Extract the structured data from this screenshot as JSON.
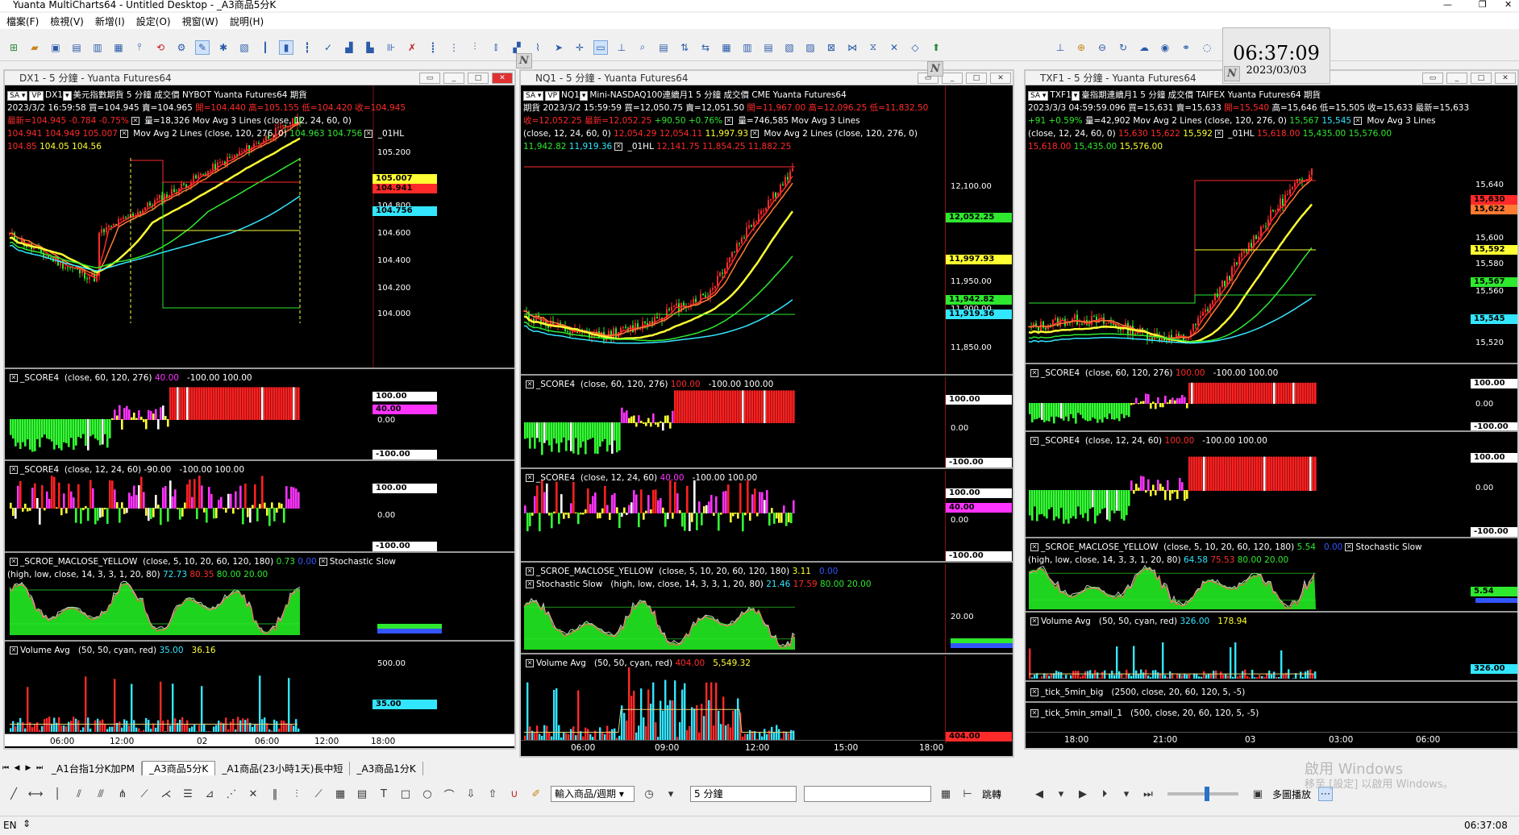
{
  "window": {
    "title": "Yuanta MultiCharts64 - Untitled Desktop - _A3商品5分K"
  },
  "menu": [
    "檔案(F)",
    "檢視(V)",
    "新增(I)",
    "設定(O)",
    "視窗(W)",
    "說明(H)"
  ],
  "clock": {
    "time": "06:37:09",
    "date": "2023/03/03"
  },
  "windows": [
    {
      "title": "DX1 - 5 分鐘 - Yuanta Futures64",
      "line1": "美元指數期貨  5 分鐘   成交價  NYBOT  Yuanta Futures64  期貨",
      "line2_white": "2023/3/2  16:59:58  買=104.945  賣=104.965 ",
      "line2_red": "開=104.440  高=105.155  低=104.420  收=104.945",
      "line3_red": "最新=104.945  -0.784  -0.75%",
      "line3_white": "  量=18,326   Mov Avg 3 Lines    (close,  12,  24,  60,  0)",
      "line4_red": "104.941  104.949  105.007",
      "line4_white": "  Mov Avg 2 Lines    (close,  120,  276,  0)  ",
      "line4_grn": "104.963  104.756",
      "line4_end": "  _01HL",
      "line5_red": "104.85",
      "line5_yel": "  104.05  104.56",
      "price_labels": [
        "105.200",
        "104.800",
        "104.600",
        "104.400",
        "104.200",
        "104.000"
      ],
      "price_tags": [
        "105.007",
        "104.941",
        "104.756"
      ],
      "p2": {
        "name": "_SCORE4",
        "params": "(close,  60,  120,  276)",
        "v": "40.00",
        "rng": "-100.00  100.00",
        "labels": [
          "100.00",
          "40.00",
          "0.00",
          "-100.00"
        ]
      },
      "p3": {
        "name": "_SCORE4",
        "params": "(close,  12,  24,  60)",
        "v": "-90.00",
        "rng": "-100.00  100.00",
        "labels": [
          "100.00",
          "0.00",
          "-100.00"
        ]
      },
      "p4": {
        "name": "_SCROE_MACLOSE_YELLOW",
        "params": "(close,  5,  10,  20,  60,  120,  180)",
        "v1": "0.73",
        "v2": "0.00",
        "name2": "Stochastic Slow",
        "params2": "(high,  low,  close,  14,  3,  3,  1,  20,  80)",
        "s1": "72.73",
        "s2": "80.35",
        "s3": "80.00",
        "s4": "20.00"
      },
      "p5": {
        "name": "Volume Avg",
        "params": "(50,  50,  cyan,  red)",
        "v1": "35.00",
        "v2": "36.16",
        "labels": [
          "500.00",
          "35.00"
        ]
      },
      "x_labels": [
        "06:00",
        "12:00",
        "02",
        "06:00",
        "12:00",
        "18:00"
      ]
    },
    {
      "title": "NQ1 - 5 分鐘 - Yuanta Futures64",
      "line1": "Mini-NASDAQ100連續月1  5 分鐘   成交價  CME  Yuanta Futures64",
      "line2_white": "期貨  2023/3/2  15:59:59  買=12,050.75  賣=12,051.50 ",
      "line2_red": "開=11,967.00  高=12,096.25  低=11,832.50",
      "line3_red": "收=12,052.25  最新=12,052.25",
      "line3_grn": "  +90.50  +0.76%",
      "line3_white": "  量=746,585   Mov Avg 3 Lines",
      "line4_white": "(close,  12,  24,  60,  0)  ",
      "line4_red": "12,054.29  12,054.11",
      "line4_yel": "  11,997.93",
      "line4_white2": "  Mov Avg 2 Lines    (close,  120,  276,  0)",
      "line5_grn": "11,942.82",
      "line5_cy": "  11,919.36",
      "line5_white": "  _01HL  ",
      "line5_red": "12,141.75  11,854.25  11,882.25",
      "price_labels": [
        "12,100.00",
        "11,950.00",
        "11,900.00",
        "11,850.00"
      ],
      "price_tags": [
        "12,052.25",
        "11,997.93",
        "11,942.82",
        "11,919.36"
      ],
      "p2": {
        "name": "_SCORE4",
        "params": "(close,  60,  120,  276)",
        "v": "100.00",
        "rng": "-100.00  100.00",
        "labels": [
          "100.00",
          "0.00",
          "-100.00"
        ]
      },
      "p3": {
        "name": "_SCORE4",
        "params": "(close,  12,  24,  60)",
        "v": "40.00",
        "rng": "-100.00  100.00",
        "labels": [
          "100.00",
          "40.00",
          "0.00",
          "-100.00"
        ]
      },
      "p4": {
        "name": "_SCROE_MACLOSE_YELLOW",
        "params": "(close,  5,  10,  20,  60,  120,  180)",
        "v1": "3.11",
        "v2": "0.00",
        "name2": "Stochastic Slow",
        "params2": "(high,  low,  close,  14,  3,  3,  1,  20,  80)",
        "s1": "21.46",
        "s2": "17.59",
        "s3": "80.00",
        "s4": "20.00",
        "labels": [
          "20.00"
        ]
      },
      "p5": {
        "name": "Volume Avg",
        "params": "(50,  50,  cyan,  red)",
        "v1": "404.00",
        "v2": "5,549.32",
        "labels": [
          "404.00"
        ]
      },
      "x_labels": [
        "06:00",
        "09:00",
        "12:00",
        "15:00",
        "18:00"
      ]
    },
    {
      "title": "TXF1 - 5 分鐘 - Yuanta Futures64",
      "line1": "臺指期連續月1  5 分鐘   成交價  TAIFEX  Yuanta Futures64  期貨",
      "line2_white": "2023/3/3  04:59:59.096  買=15,631  賣=15,633 ",
      "line2_red": "開=15,540",
      "line2_white2": "  高=15,646  低=15,505  收=15,633  最新=15,633",
      "line3_grn": "+91  +0.59%",
      "line3_white": "  量=42,902   Mov Avg 2 Lines    (close,  120,  276,  0)  ",
      "line3_grn2": "15,567",
      "line3_cy": "  15,545",
      "line3_white2": "  Mov Avg 3 Lines",
      "line4_white": "(close,  12,  24,  60,  0)  ",
      "line4_red": "15,630  15,622",
      "line4_yel": "  15,592",
      "line4_white2": "  _01HL  ",
      "line4_red2": "15,618.00",
      "line4_grn": "  15,435.00  15,576.00",
      "line5_red": "15,618.00",
      "line5_grn": "  15,435.00",
      "line5_yel": "  15,576.00",
      "price_labels": [
        "15,640",
        "15,600",
        "15,580",
        "15,560",
        "15,520"
      ],
      "price_tags": [
        "15,630",
        "15,622",
        "15,592",
        "15,567",
        "15,545"
      ],
      "p2": {
        "name": "_SCORE4",
        "params": "(close,  60,  120,  276)",
        "v": "100.00",
        "rng": "-100.00  100.00",
        "labels": [
          "100.00",
          "0.00",
          "-100.00"
        ]
      },
      "p3": {
        "name": "_SCORE4",
        "params": "(close,  12,  24,  60)",
        "v": "100.00",
        "rng": "-100.00  100.00",
        "labels": [
          "100.00",
          "0.00",
          "-100.00"
        ]
      },
      "p4": {
        "name": "_SCROE_MACLOSE_YELLOW",
        "params": "(close,  5,  10,  20,  60,  120,  180)",
        "v1": "5.54",
        "v2": "0.00",
        "name2": "Stochastic Slow",
        "params2": "(high,  low,  close,  14,  3,  3,  1,  20,  80)",
        "s1": "64.58",
        "s2": "75.53",
        "s3": "80.00",
        "s4": "20.00",
        "labels": [
          "5.54"
        ]
      },
      "p5": {
        "name": "Volume Avg",
        "params": "(50,  50,  cyan,  red)",
        "v1": "326.00",
        "v2": "178.94",
        "labels": [
          "326.00"
        ]
      },
      "p6": {
        "name": "_tick_5min_big",
        "params": "(2500,  close,  20,  60,  120,  5,  -5)"
      },
      "p7": {
        "name": "_tick_5min_small_1",
        "params": "(500,  close,  20,  60,  120,  5,  -5)"
      },
      "x_labels": [
        "18:00",
        "21:00",
        "03",
        "03:00",
        "06:00"
      ]
    }
  ],
  "sheet_tabs": [
    "_A1台指1分K加PM",
    "_A3商品5分K",
    "_A1商品(23小時1天)長中短",
    "_A3商品1分K"
  ],
  "active_sheet": "_A3商品5分K",
  "drawbar": {
    "symbol_select": "輸入商品/週期",
    "period_select": "5 分鐘",
    "jump": "跳轉",
    "playback": "多圖播放"
  },
  "status": {
    "lang": "EN",
    "time": "06:37:08"
  },
  "watermark": {
    "line1": "啟用 Windows",
    "line2": "移至 [設定] 以啟用 Windows。"
  },
  "badge_label": "N"
}
